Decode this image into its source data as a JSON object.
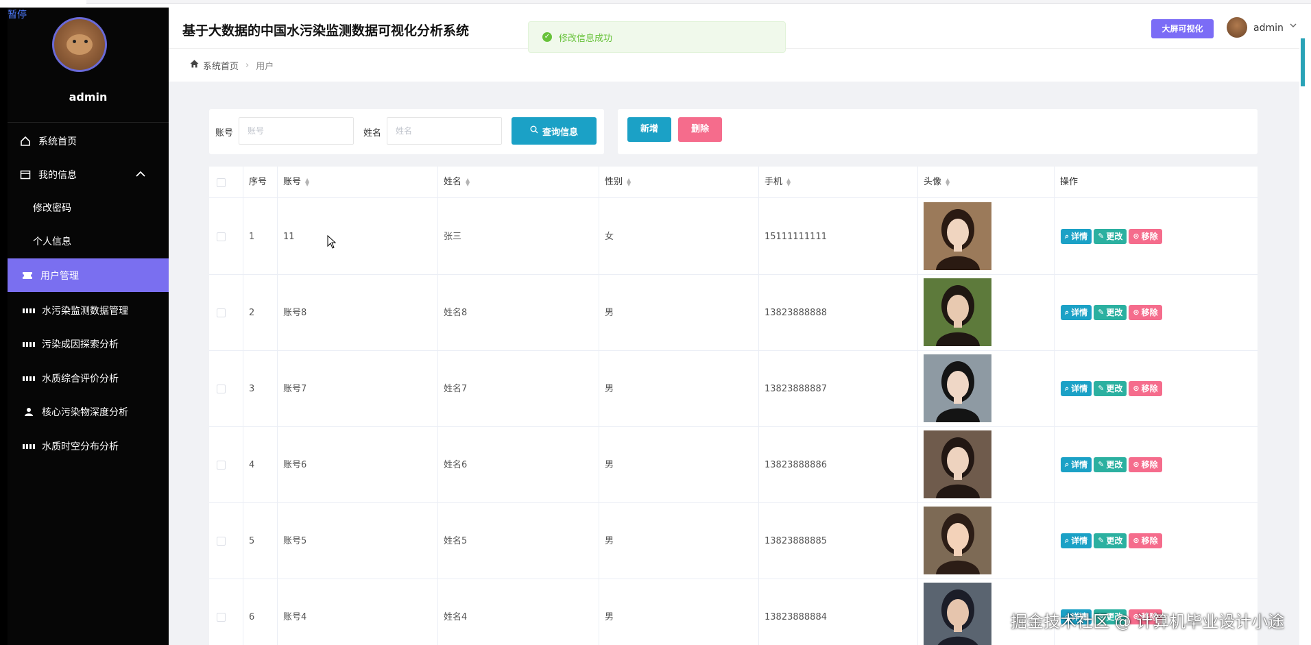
{
  "overlay": {
    "pause": "暂停"
  },
  "sidebar": {
    "username": "admin",
    "menu": [
      {
        "label": "系统首页",
        "icon": "home-icon"
      },
      {
        "label": "我的信息",
        "icon": "card-icon"
      },
      {
        "label": "修改密码"
      },
      {
        "label": "个人信息"
      },
      {
        "label": "用户管理",
        "icon": "ticket-icon"
      },
      {
        "label": "水污染监测数据管理",
        "icon": "grid-icon"
      },
      {
        "label": "污染成因探索分析",
        "icon": "grid-icon"
      },
      {
        "label": "水质综合评价分析",
        "icon": "grid-icon"
      },
      {
        "label": "核心污染物深度分析",
        "icon": "person-icon"
      },
      {
        "label": "水质时空分布分析",
        "icon": "grid-icon"
      }
    ]
  },
  "header": {
    "title": "基于大数据的中国水污染监测数据可视化分析系统",
    "toast": "修改信息成功",
    "bigscreen": "大屏可视化",
    "user": "admin"
  },
  "breadcrumb": {
    "home": "系统首页",
    "current": "用户"
  },
  "search": {
    "account_label": "账号",
    "account_placeholder": "账号",
    "name_label": "姓名",
    "name_placeholder": "姓名",
    "query_button": "查询信息"
  },
  "actions": {
    "add": "新增",
    "delete": "删除"
  },
  "table": {
    "columns": [
      "序号",
      "账号",
      "姓名",
      "性别",
      "手机",
      "头像",
      "操作"
    ],
    "op_labels": {
      "detail": "详情",
      "edit": "更改",
      "remove": "移除"
    },
    "rows": [
      {
        "idx": "1",
        "account": "11",
        "name": "张三",
        "gender": "女",
        "phone": "15111111111"
      },
      {
        "idx": "2",
        "account": "账号8",
        "name": "姓名8",
        "gender": "男",
        "phone": "13823888888"
      },
      {
        "idx": "3",
        "account": "账号7",
        "name": "姓名7",
        "gender": "男",
        "phone": "13823888887"
      },
      {
        "idx": "4",
        "account": "账号6",
        "name": "姓名6",
        "gender": "男",
        "phone": "13823888886"
      },
      {
        "idx": "5",
        "account": "账号5",
        "name": "姓名5",
        "gender": "男",
        "phone": "13823888885"
      },
      {
        "idx": "6",
        "account": "账号4",
        "name": "姓名4",
        "gender": "男",
        "phone": "13823888884"
      }
    ]
  },
  "watermark": "掘金技术社区 @ 计算机毕业设计小途",
  "colors": {
    "accent": "#7a6ff0",
    "primary": "#1ba1c6",
    "danger": "#f56c8c",
    "success": "#67c23a"
  }
}
